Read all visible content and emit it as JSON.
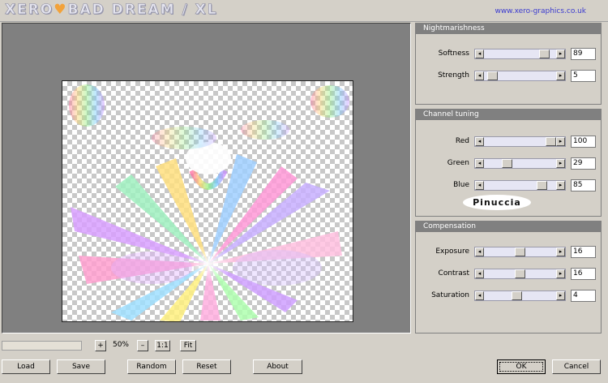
{
  "header": {
    "title_part1": "XERO",
    "title_heart": "♥",
    "title_part2": "BAD DREAM / XL",
    "website": "www.xero-graphics.co.uk"
  },
  "panels": {
    "nightmarishness": {
      "title": "Nightmarishness",
      "sliders": [
        {
          "label": "Softness",
          "value": "89",
          "level": 0.89
        },
        {
          "label": "Strength",
          "value": "5",
          "level": 0.05
        }
      ]
    },
    "channel_tuning": {
      "title": "Channel tuning",
      "sliders": [
        {
          "label": "Red",
          "value": "100",
          "level": 1.0
        },
        {
          "label": "Green",
          "value": "29",
          "level": 0.29
        },
        {
          "label": "Blue",
          "value": "85",
          "level": 0.85
        }
      ],
      "signature": "Pinuccia"
    },
    "compensation": {
      "title": "Compensation",
      "sliders": [
        {
          "label": "Exposure",
          "value": "16",
          "level": 0.5
        },
        {
          "label": "Contrast",
          "value": "16",
          "level": 0.5
        },
        {
          "label": "Saturation",
          "value": "4",
          "level": 0.45
        }
      ]
    }
  },
  "zoom": {
    "plus": "+",
    "level": "50%",
    "minus": "–",
    "actual": "1:1",
    "fit": "Fit"
  },
  "buttons": {
    "load": "Load",
    "save": "Save",
    "random": "Random",
    "reset": "Reset",
    "about": "About",
    "ok": "OK",
    "cancel": "Cancel"
  },
  "arrows": {
    "left": "◂",
    "right": "▸"
  }
}
